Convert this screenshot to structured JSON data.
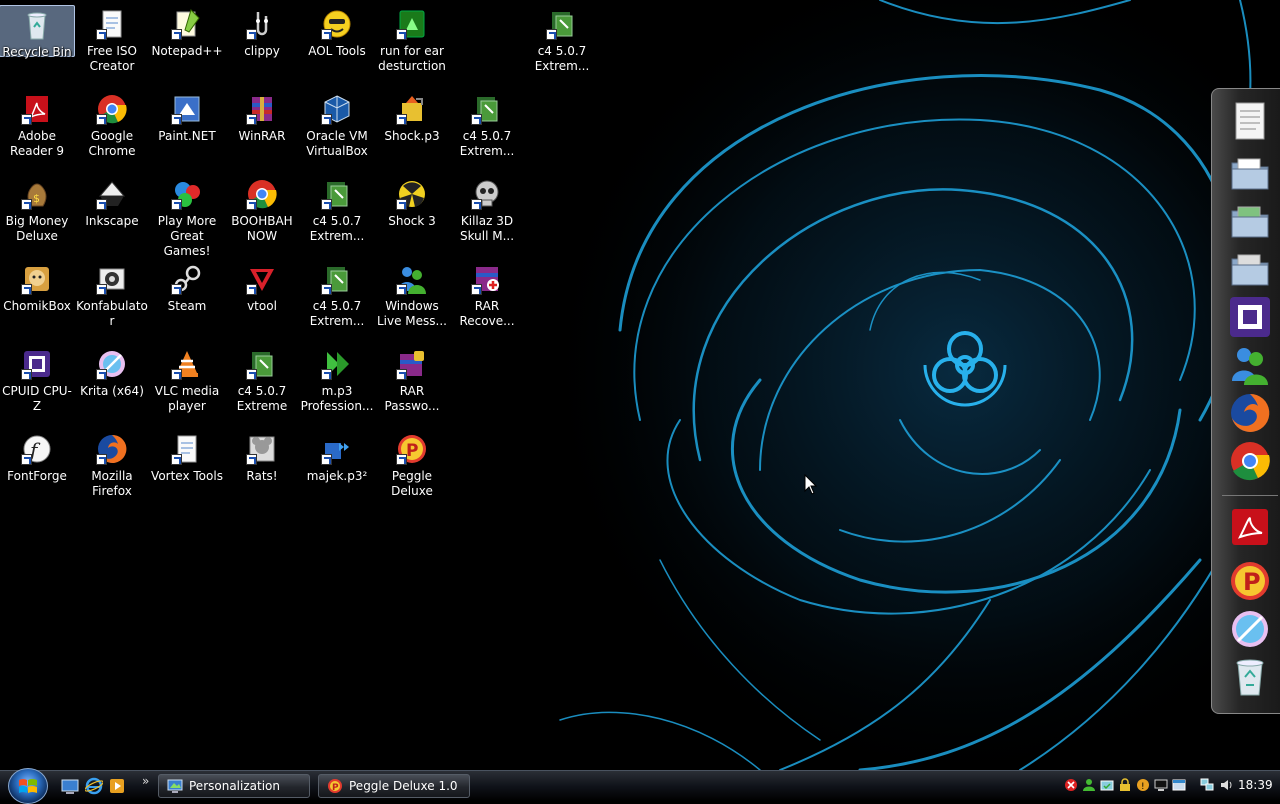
{
  "desktop": {
    "icons": [
      {
        "label": "Recycle Bin"
      },
      {
        "label": "Free ISO Creator"
      },
      {
        "label": "Notepad++"
      },
      {
        "label": "clippy"
      },
      {
        "label": "AOL Tools"
      },
      {
        "label": "run for ear desturction"
      },
      {
        "label": "c4 5.0.7 Extrem..."
      },
      {
        "label": "Adobe Reader 9"
      },
      {
        "label": "Google Chrome"
      },
      {
        "label": "Paint.NET"
      },
      {
        "label": "WinRAR"
      },
      {
        "label": "Oracle VM VirtualBox"
      },
      {
        "label": "Shock.p3"
      },
      {
        "label": "c4 5.0.7 Extrem..."
      },
      {
        "label": "Big Money Deluxe"
      },
      {
        "label": "Inkscape"
      },
      {
        "label": "Play More Great Games!"
      },
      {
        "label": "BOOHBAH NOW"
      },
      {
        "label": "c4 5.0.7 Extrem..."
      },
      {
        "label": "Shock 3"
      },
      {
        "label": "Killaz 3D Skull M..."
      },
      {
        "label": "ChomikBox"
      },
      {
        "label": "Konfabulator"
      },
      {
        "label": "Steam"
      },
      {
        "label": "vtool"
      },
      {
        "label": "c4 5.0.7 Extrem..."
      },
      {
        "label": "Windows Live Mess..."
      },
      {
        "label": "RAR Recove..."
      },
      {
        "label": "CPUID CPU-Z"
      },
      {
        "label": "Krita (x64)"
      },
      {
        "label": "VLC media player"
      },
      {
        "label": "c4 5.0.7 Extreme"
      },
      {
        "label": "m.p3 Profession..."
      },
      {
        "label": "RAR Passwo..."
      },
      {
        "label": "FontForge"
      },
      {
        "label": "Mozilla Firefox"
      },
      {
        "label": "Vortex Tools"
      },
      {
        "label": "Rats!"
      },
      {
        "label": "majek.p3²"
      },
      {
        "label": "Peggle Deluxe"
      }
    ]
  },
  "taskbar": {
    "buttons": [
      {
        "label": "Personalization"
      },
      {
        "label": "Peggle Deluxe 1.0"
      }
    ],
    "quicklaunch_more": "»",
    "clock": "18:39"
  },
  "colors": {
    "wallpaper_glow": "#1fa6e0",
    "taskbar_bg": "#10131a"
  }
}
